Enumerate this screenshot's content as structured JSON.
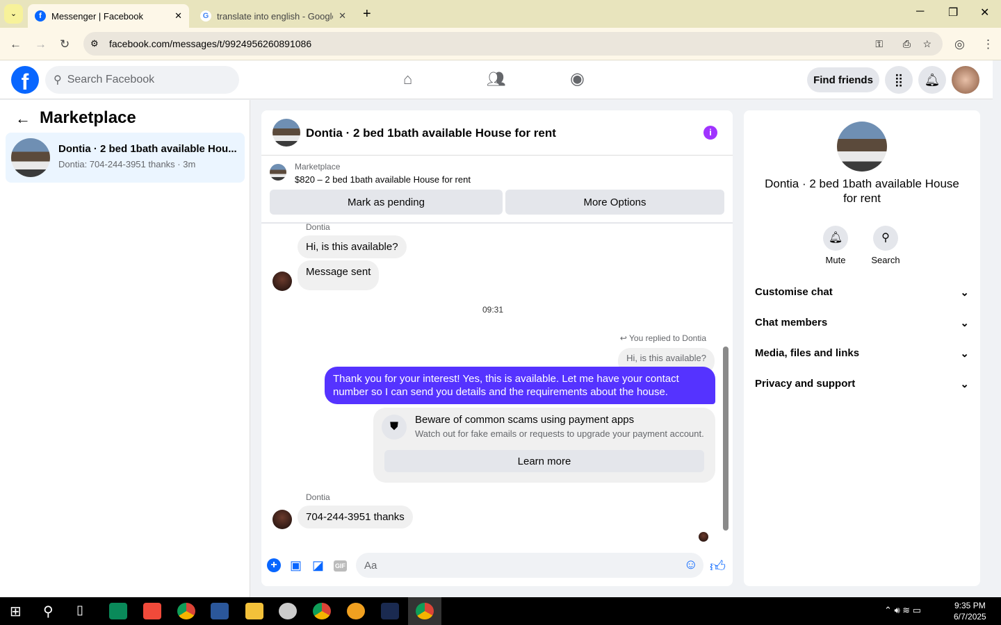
{
  "browser": {
    "tabs": [
      {
        "title": "Messenger | Facebook",
        "active": true
      },
      {
        "title": "translate into english - Google S"
      }
    ],
    "url": "facebook.com/messages/t/9924956260891086"
  },
  "fb": {
    "search_placeholder": "Search Facebook",
    "find_friends": "Find friends"
  },
  "left": {
    "title": "Marketplace",
    "threads": [
      {
        "name": "Dontia · 2 bed 1bath available Hou...",
        "preview": "Dontia: 704-244-3951 thanks",
        "time": "3m"
      }
    ]
  },
  "chat": {
    "title": "Dontia · 2 bed 1bath available House for rent",
    "listing": {
      "label": "Marketplace",
      "desc": "$820 – 2 bed 1bath available House for rent",
      "mark_pending": "Mark as pending",
      "more_options": "More Options"
    },
    "messages": [
      {
        "sender": "Dontia",
        "text": "Hi, is this available?"
      },
      {
        "text": "Message sent"
      },
      {
        "time": "09:31"
      },
      {
        "reply_label": "You replied to Dontia",
        "quoted": "Hi, is this available?",
        "text": "Thank you for your interest! Yes, this is available. Let me have your contact number so I can send you details and the requirements about the house."
      },
      {
        "sender": "Dontia",
        "text": "704-244-3951 thanks"
      }
    ],
    "warning": {
      "title": "Beware of common scams using payment apps",
      "body": "Watch out for fake emails or requests to upgrade your payment account.",
      "button": "Learn more"
    },
    "composer_placeholder": "Aa"
  },
  "right": {
    "title": "Dontia · 2 bed 1bath available House for rent",
    "actions": [
      "Mute",
      "Search"
    ],
    "sections": [
      "Customise chat",
      "Chat members",
      "Media, files and links",
      "Privacy and support"
    ]
  },
  "taskbar": {
    "time": "9:35 PM",
    "date": "6/7/2025"
  },
  "colors": {
    "brand": "#0866ff",
    "outgoing": "#5533ff",
    "info": "#a033ff"
  }
}
